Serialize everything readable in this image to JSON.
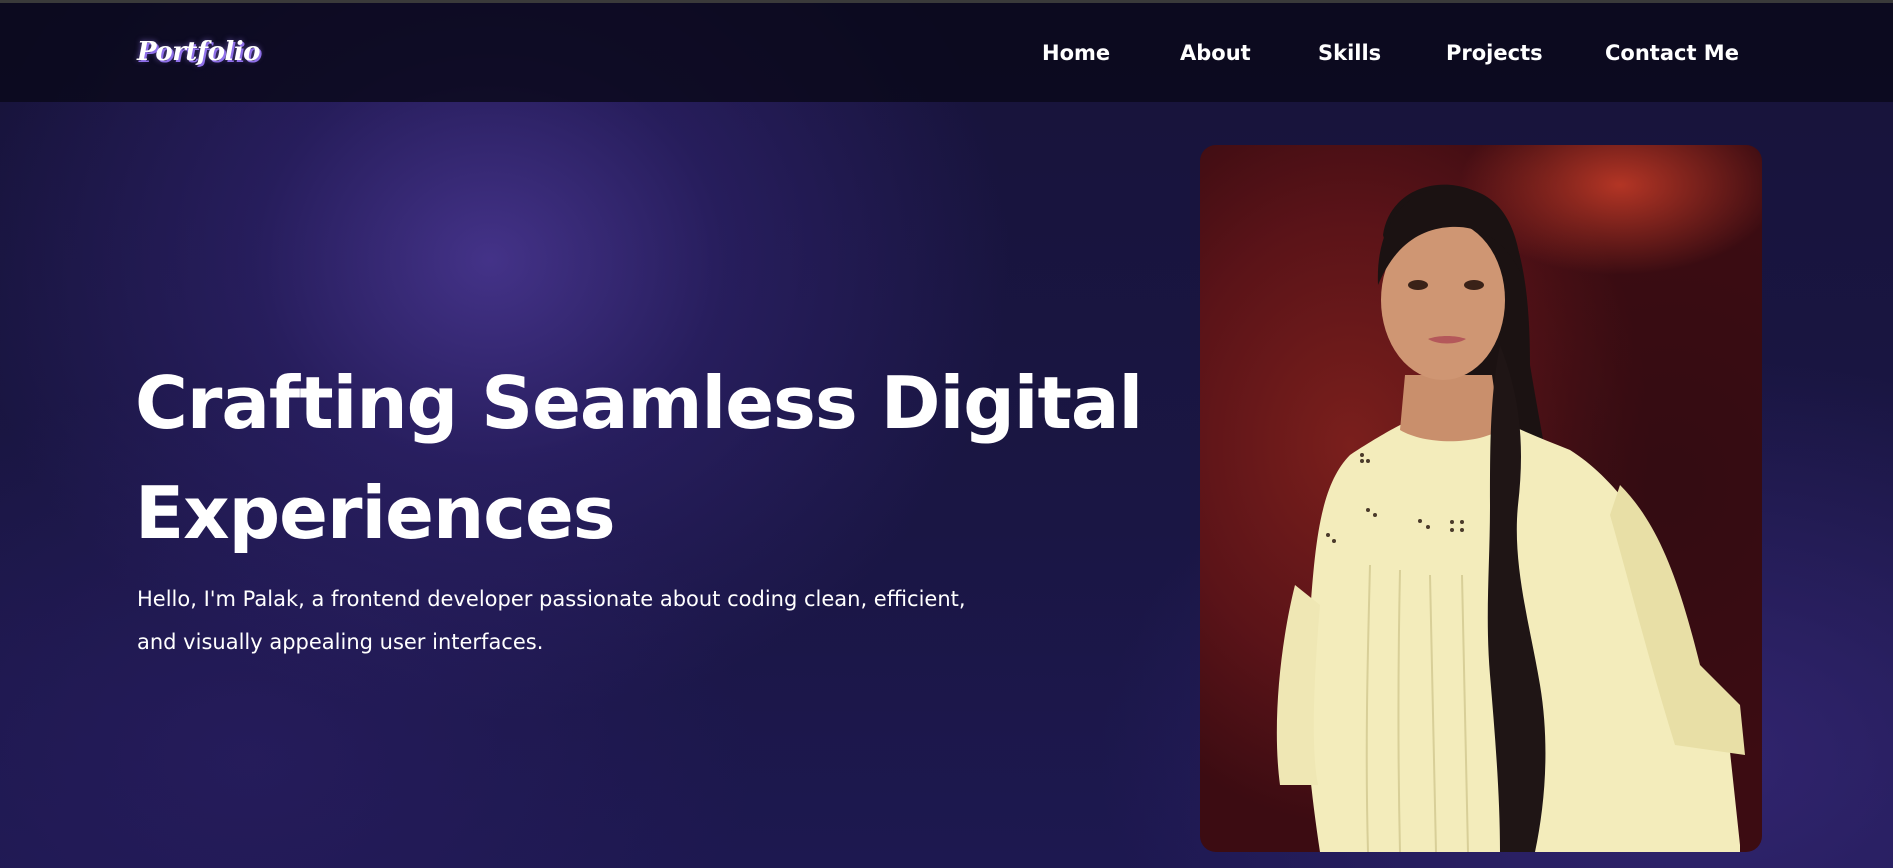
{
  "header": {
    "logo_text": "Portfolio",
    "nav_items": [
      {
        "label": "Home"
      },
      {
        "label": "About"
      },
      {
        "label": "Skills"
      },
      {
        "label": "Projects"
      },
      {
        "label": "Contact Me"
      }
    ]
  },
  "hero": {
    "title_line1": "Crafting Seamless Digital",
    "title_line2": "Experiences",
    "subtitle_line1": "Hello, I'm Palak, a frontend developer passionate about coding clean, efficient,",
    "subtitle_line2": "and visually appealing user interfaces.",
    "photo_icon": "profile-photo"
  },
  "colors": {
    "background": "#17133a",
    "navbar_bg": "#0a081a",
    "text": "#ffffff",
    "logo_shadow": "#8e6fe8",
    "photo_bg": "#7a1f1c"
  }
}
